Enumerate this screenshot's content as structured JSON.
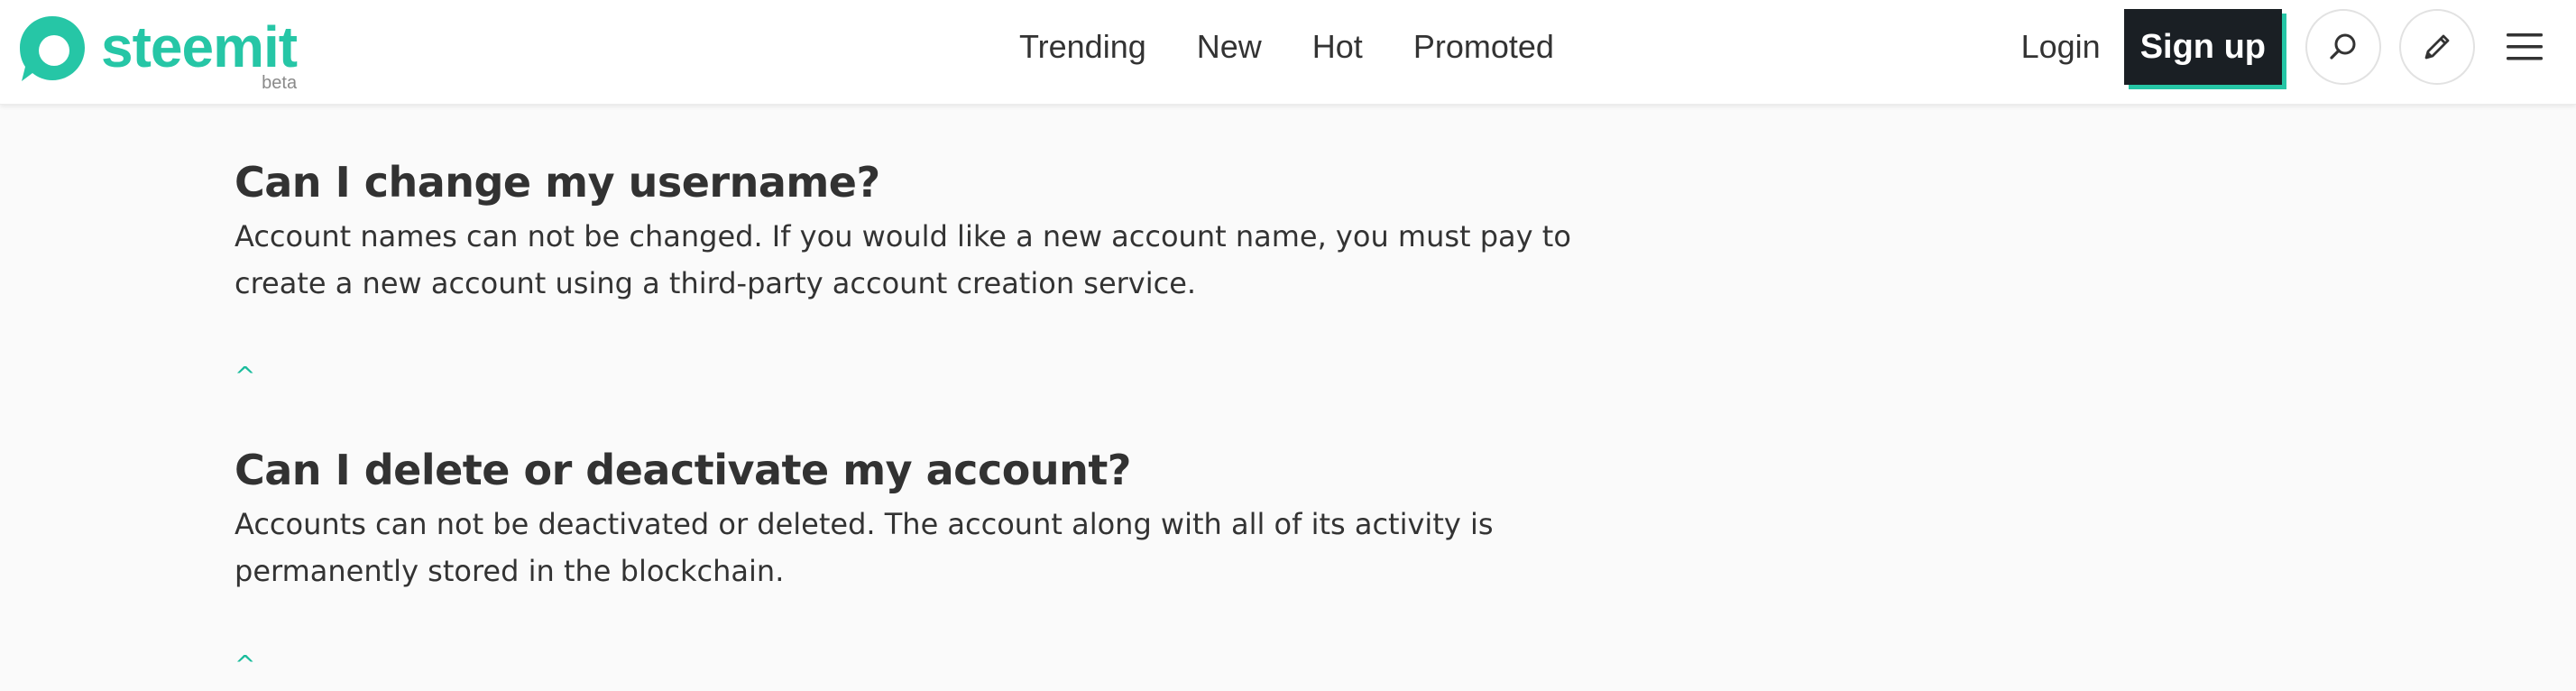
{
  "brand": {
    "name": "steemit",
    "badge": "beta",
    "color": "#26c6a6",
    "logo_icon": "steemit-logo-icon"
  },
  "nav": {
    "items": [
      {
        "label": "Trending"
      },
      {
        "label": "New"
      },
      {
        "label": "Hot"
      },
      {
        "label": "Promoted"
      }
    ]
  },
  "account": {
    "login_label": "Login",
    "signup_label": "Sign up"
  },
  "icons": {
    "search": "search-icon",
    "edit": "pencil-icon",
    "menu": "hamburger-menu-icon"
  },
  "faq": [
    {
      "question": "Can I change my username?",
      "answer": "Account names can not be changed. If you would like a new account name, you must pay to create a new account using a third-party account creation service.",
      "back_to_top": "^"
    },
    {
      "question": "Can I delete or deactivate my account?",
      "answer": "Accounts can not be deactivated or deleted. The account along with all of its activity is permanently stored in the blockchain.",
      "back_to_top": "^"
    }
  ]
}
